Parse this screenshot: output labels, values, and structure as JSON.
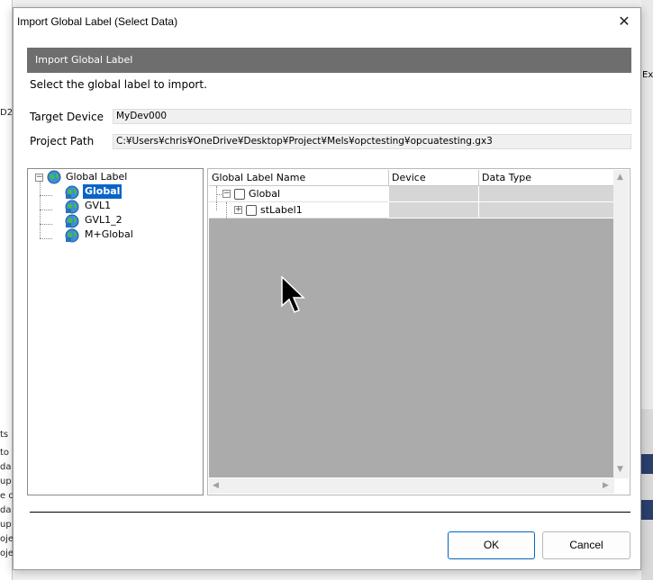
{
  "background": {
    "left_fragments": [
      "D2",
      "ts",
      "to",
      "da",
      "up",
      "e cy",
      "da",
      "up",
      "oje",
      "oje"
    ],
    "right_fragment": "Ext"
  },
  "dialog": {
    "title": "Import Global Label (Select Data)",
    "close_glyph": "✕",
    "header": "Import Global Label",
    "instruction": "Select the global label to import.",
    "target_device_label": "Target Device",
    "target_device_value": "MyDev000",
    "project_path_label": "Project Path",
    "project_path_value": "C:¥Users¥chris¥OneDrive¥Desktop¥Project¥Mels¥opctesting¥opcuatesting.gx3"
  },
  "tree": {
    "root": {
      "label": "Global Label",
      "expander": "−"
    },
    "children": [
      {
        "label": "Global",
        "selected": true
      },
      {
        "label": "GVL1",
        "selected": false
      },
      {
        "label": "GVL1_2",
        "selected": false
      },
      {
        "label": "M+Global",
        "selected": false
      }
    ]
  },
  "grid": {
    "columns": [
      "Global Label Name",
      "Device",
      "Data Type"
    ],
    "rows": [
      {
        "name": "Global",
        "expander": "−"
      },
      {
        "name": "stLabel1",
        "expander": "+"
      }
    ],
    "scroll_up": "▲",
    "scroll_down": "▼",
    "scroll_left": "◀",
    "scroll_right": "▶"
  },
  "buttons": {
    "ok": "OK",
    "cancel": "Cancel"
  },
  "colors": {
    "header_bar": "#6e6e6e",
    "selection": "#0a64c8",
    "grid_empty": "#ababab"
  },
  "icons": [
    "globe-icon",
    "close-icon",
    "mouse-cursor-icon"
  ]
}
